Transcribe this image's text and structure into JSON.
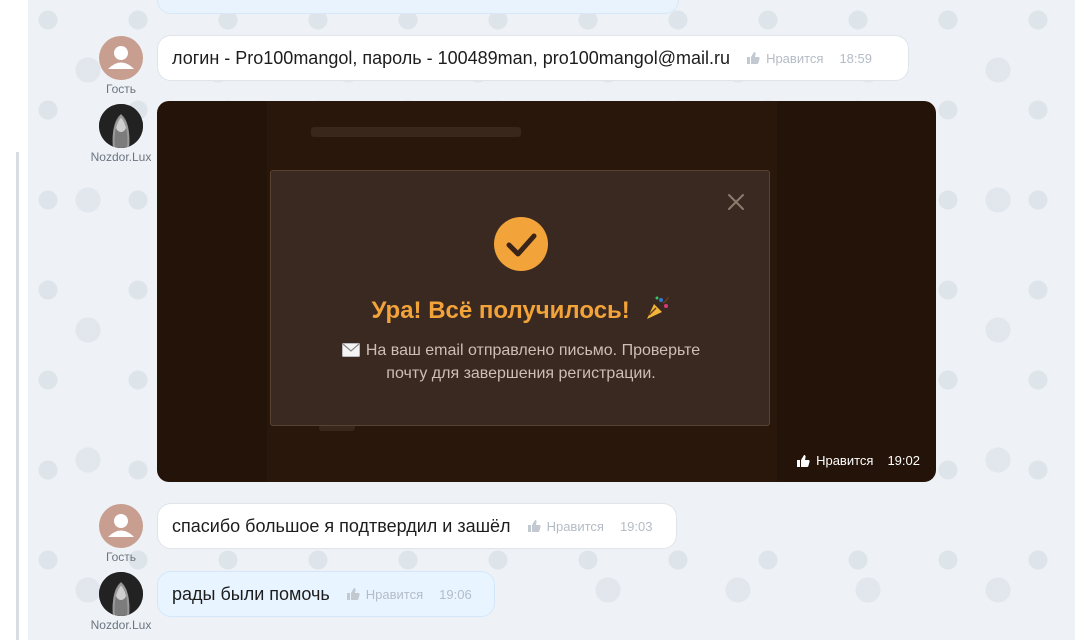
{
  "messages": [
    {
      "author": "Гость",
      "text": "логин - Pro100mangol, пароль - 100489man, pro100mangol@mail.ru",
      "like_label": "Нравится",
      "time": "18:59"
    },
    {
      "author": "Nozdor.Lux",
      "image": {
        "title": "Ура! Всё получилось!",
        "text_line1": "На ваш email отправлено письмо. Проверьте",
        "text_line2": "почту для завершения регистрации.",
        "close_icon": "close-icon",
        "check_icon": "check-circle-icon",
        "accent_color": "#f2a33a"
      },
      "like_label": "Нравится",
      "time": "19:02"
    },
    {
      "author": "Гость",
      "text": "спасибо большое я подтвердил и зашёл",
      "like_label": "Нравится",
      "time": "19:03"
    },
    {
      "author": "Nozdor.Lux",
      "text": "рады были помочь",
      "like_label": "Нравится",
      "time": "19:06"
    }
  ],
  "colors": {
    "chat_background": "#eef2f6",
    "own_bubble": "#e8f4ff",
    "other_bubble": "#ffffff",
    "meta_text": "#b4bcc6"
  }
}
